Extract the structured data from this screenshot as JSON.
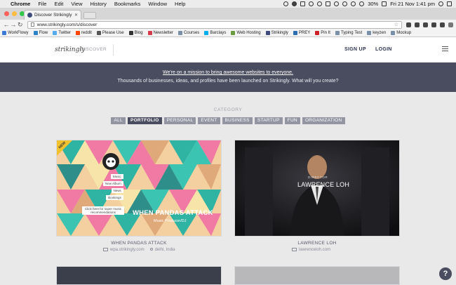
{
  "menubar": {
    "app": "Chrome",
    "items": [
      "File",
      "Edit",
      "View",
      "History",
      "Bookmarks",
      "Window",
      "Help"
    ],
    "battery": "30%",
    "clock": "Fri 21 Nov  1:41 pm"
  },
  "browser": {
    "tab_title": "Discover Strikingly Sites",
    "url": "www.strikingly.com/s/discover",
    "bookmarks": [
      {
        "label": "WorkFlowy",
        "color": "#3b7bd6"
      },
      {
        "label": "Flow",
        "color": "#2c83c6"
      },
      {
        "label": "Twitter",
        "color": "#55acee"
      },
      {
        "label": "reddit",
        "color": "#ff4500"
      },
      {
        "label": "Please Use",
        "color": "#555555"
      },
      {
        "label": "Blog",
        "color": "#333333"
      },
      {
        "label": "Newsletter",
        "color": "#d6394a"
      },
      {
        "label": "Courses",
        "color": "#7a8fa8"
      },
      {
        "label": "Barclays",
        "color": "#00aeef"
      },
      {
        "label": "Web Hosting",
        "color": "#6a9b3c"
      },
      {
        "label": "Strikingly",
        "color": "#3d4a7c"
      },
      {
        "label": "PREY",
        "color": "#2b6fb1"
      },
      {
        "label": "Pin It",
        "color": "#cb2027"
      },
      {
        "label": "Typing Test",
        "color": "#7a8fa8"
      },
      {
        "label": "keyzen",
        "color": "#7a8fa8"
      },
      {
        "label": "Mockup",
        "color": "#7a8fa8"
      }
    ]
  },
  "header": {
    "logo": "strikingly",
    "logo_sub": "DISCOVER",
    "signup": "SIGN UP",
    "login": "LOGIN"
  },
  "banner": {
    "line1": "We're on a mission to bring awesome websites to everyone.",
    "line2": "Thousands of businesses, ideas, and profiles have been launched on Strikingly. What will you create?"
  },
  "category": {
    "title": "CATEGORY",
    "filters": [
      "ALL",
      "PORTFOLIO",
      "PERSONAL",
      "EVENT",
      "BUSINESS",
      "STARTUP",
      "FUN",
      "ORGANIZATION"
    ],
    "active": "PORTFOLIO"
  },
  "cards": [
    {
      "badge": "NEW",
      "name": "WHEN PANDAS ATTACK",
      "hero_title": "WHEN PANDAS ATTACK",
      "hero_subtitle": "Music Producer/DJ",
      "menu": [
        "Music",
        "New Album",
        "News",
        "Bookings"
      ],
      "cta": "Click here for super music recommendations",
      "site": "wpa.strikingly.com",
      "location": "delhi, India"
    },
    {
      "name": "LAWRENCE LOH",
      "hero_title": "LAWRENCE LOH",
      "hero_kicker": "DIRECTOR",
      "site": "lawrenceloh.com"
    }
  ],
  "help": "?"
}
